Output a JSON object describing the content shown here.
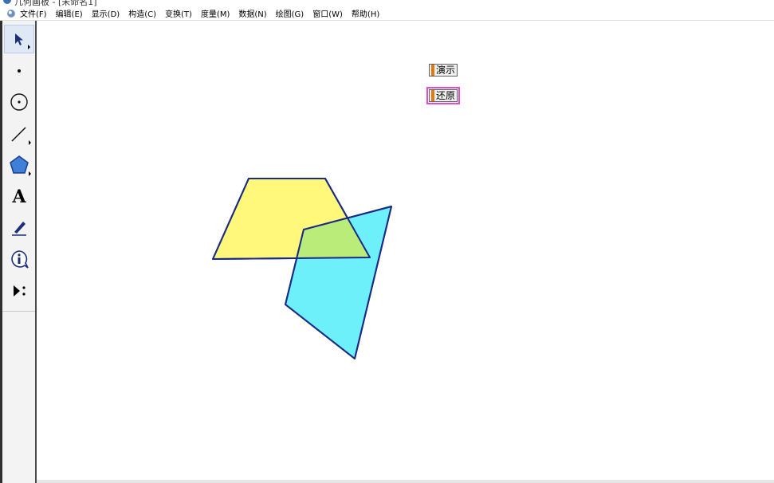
{
  "window": {
    "title": "几何画板 - [未命名1]"
  },
  "menubar": {
    "items": [
      {
        "label": "文件(F)"
      },
      {
        "label": "编辑(E)"
      },
      {
        "label": "显示(D)"
      },
      {
        "label": "构造(C)"
      },
      {
        "label": "变换(T)"
      },
      {
        "label": "度量(M)"
      },
      {
        "label": "数据(N)"
      },
      {
        "label": "绘图(G)"
      },
      {
        "label": "窗口(W)"
      },
      {
        "label": "帮助(H)"
      }
    ]
  },
  "toolbox": {
    "tools": [
      {
        "name": "arrow-tool-icon",
        "selected": true
      },
      {
        "name": "point-tool-icon",
        "selected": false
      },
      {
        "name": "compass-tool-icon",
        "selected": false
      },
      {
        "name": "straightedge-tool-icon",
        "selected": false
      },
      {
        "name": "polygon-tool-icon",
        "selected": false
      },
      {
        "name": "text-tool-icon",
        "text": "A",
        "selected": false
      },
      {
        "name": "marker-tool-icon",
        "selected": false
      },
      {
        "name": "information-tool-icon",
        "selected": false
      },
      {
        "name": "custom-tool-icon",
        "selected": false
      }
    ]
  },
  "canvas": {
    "buttons": {
      "demo_label": "演示",
      "restore_label": "还原"
    },
    "shapes": {
      "trapezoid": {
        "fill": "#fff87a",
        "stroke": "#1a2a86"
      },
      "quadrilateral": {
        "fill": "#6ef0fb",
        "stroke": "#1a2a86"
      },
      "overlap": {
        "fill": "#b9ec78"
      }
    },
    "colors": {
      "button_handle": "#e07a12",
      "button_highlight": "#e64ad2"
    }
  }
}
